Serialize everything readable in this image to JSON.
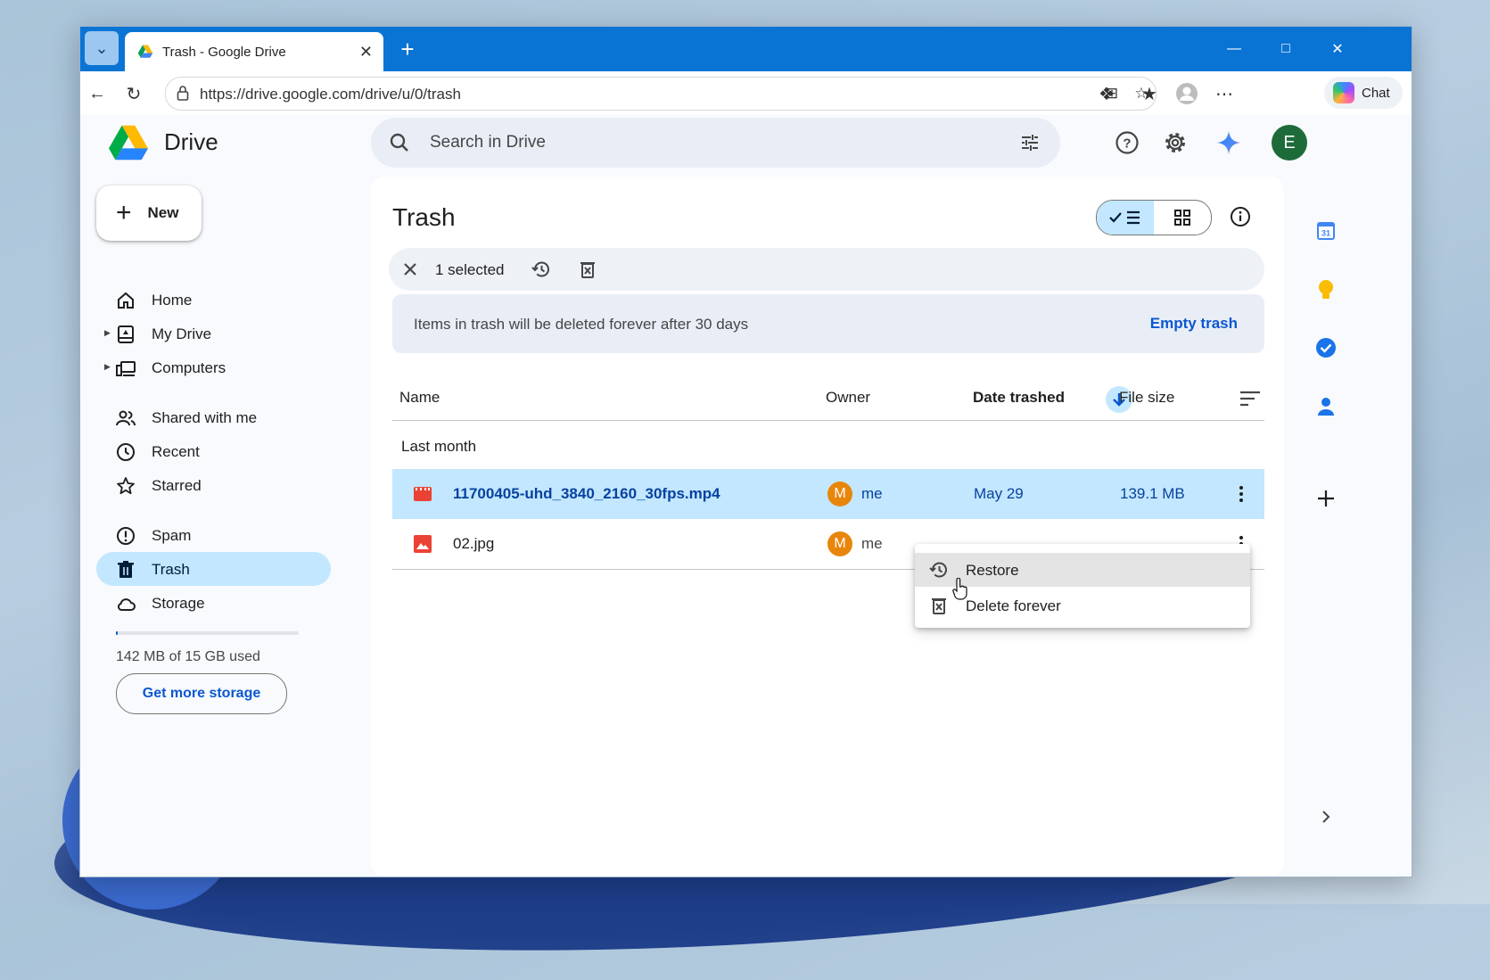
{
  "browser": {
    "tab_title": "Trash - Google Drive",
    "url": "https://drive.google.com/drive/u/0/trash",
    "copilot_label": "Chat"
  },
  "drive": {
    "app_name": "Drive",
    "search_placeholder": "Search in Drive",
    "account_initial": "E",
    "new_label": "New",
    "nav": [
      {
        "label": "Home"
      },
      {
        "label": "My Drive"
      },
      {
        "label": "Computers"
      },
      {
        "label": "Shared with me"
      },
      {
        "label": "Recent"
      },
      {
        "label": "Starred"
      },
      {
        "label": "Spam"
      },
      {
        "label": "Trash"
      },
      {
        "label": "Storage"
      }
    ],
    "storage_text": "142 MB of 15 GB used",
    "storage_fraction": 0.009,
    "get_storage_label": "Get more storage"
  },
  "trash": {
    "title": "Trash",
    "selection_count": "1 selected",
    "notice": "Items in trash will be deleted forever after 30 days",
    "empty_trash": "Empty trash",
    "columns": {
      "name": "Name",
      "owner": "Owner",
      "date": "Date trashed",
      "size": "File size"
    },
    "group_label": "Last month",
    "files": [
      {
        "name": "11700405-uhd_3840_2160_30fps.mp4",
        "owner_initial": "M",
        "owner": "me",
        "date": "May 29",
        "size": "139.1 MB",
        "icon": "video-icon"
      },
      {
        "name": "02.jpg",
        "owner_initial": "M",
        "owner": "me",
        "date": "",
        "size": "",
        "icon": "image-icon"
      }
    ],
    "context_menu": [
      {
        "label": "Restore",
        "icon": "restore-icon"
      },
      {
        "label": "Delete forever",
        "icon": "delete-forever-icon"
      }
    ]
  },
  "colors": {
    "accent": "#0b57d0",
    "selected_bg": "#c2e7ff",
    "browser_titlebar": "#0a74d4",
    "avatar_bg": "#1e6b3a",
    "owner_avatar_bg": "#e8860b"
  },
  "side_panel": {
    "calendar_day": "31"
  }
}
